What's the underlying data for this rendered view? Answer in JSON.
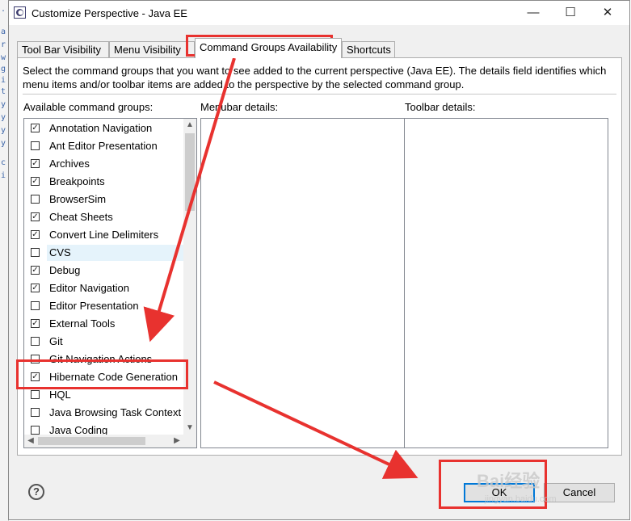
{
  "window": {
    "title": "Customize Perspective - Java EE",
    "minimize": "—",
    "maximize": "☐",
    "close": "✕"
  },
  "background_strip": [
    ".",
    "a",
    "r",
    "w",
    "g",
    "i",
    "t",
    "y",
    "y",
    "y",
    "y",
    "c",
    "i"
  ],
  "tabs": [
    {
      "label": "Tool Bar Visibility"
    },
    {
      "label": "Menu Visibility"
    },
    {
      "label": "Command Groups Availability"
    },
    {
      "label": "Shortcuts"
    }
  ],
  "active_tab_index": 2,
  "description": "Select the command groups that you want to see added to the current perspective (Java EE).  The details field identifies which menu items and/or toolbar items are added to the perspective by the selected command group.",
  "labels": {
    "available": "Available command groups:",
    "menubar": "Menubar details:",
    "toolbar": "Toolbar details:"
  },
  "command_groups": [
    {
      "label": "Annotation Navigation",
      "checked": true
    },
    {
      "label": "Ant Editor Presentation",
      "checked": false
    },
    {
      "label": "Archives",
      "checked": true
    },
    {
      "label": "Breakpoints",
      "checked": true
    },
    {
      "label": "BrowserSim",
      "checked": false
    },
    {
      "label": "Cheat Sheets",
      "checked": true
    },
    {
      "label": "Convert Line Delimiters",
      "checked": true
    },
    {
      "label": "CVS",
      "checked": false,
      "selected": true
    },
    {
      "label": "Debug",
      "checked": true
    },
    {
      "label": "Editor Navigation",
      "checked": true
    },
    {
      "label": "Editor Presentation",
      "checked": false
    },
    {
      "label": "External Tools",
      "checked": true
    },
    {
      "label": "Git",
      "checked": false
    },
    {
      "label": "Git Navigation Actions",
      "checked": false
    },
    {
      "label": "Hibernate Code Generation",
      "checked": true
    },
    {
      "label": "HQL",
      "checked": false
    },
    {
      "label": "Java Browsing Task Context",
      "checked": false
    },
    {
      "label": "Java Coding",
      "checked": false
    }
  ],
  "scroll_arrows": {
    "up": "▲",
    "down": "▼",
    "left": "◀",
    "right": "▶"
  },
  "buttons": {
    "help": "?",
    "ok": "OK",
    "cancel": "Cancel"
  },
  "watermark": {
    "main": "Bai经验",
    "sub": "jingyan.baidu.com"
  },
  "colors": {
    "accent": "#0078d7",
    "annotation": "#e8322f",
    "selection": "#e5f3fb"
  }
}
